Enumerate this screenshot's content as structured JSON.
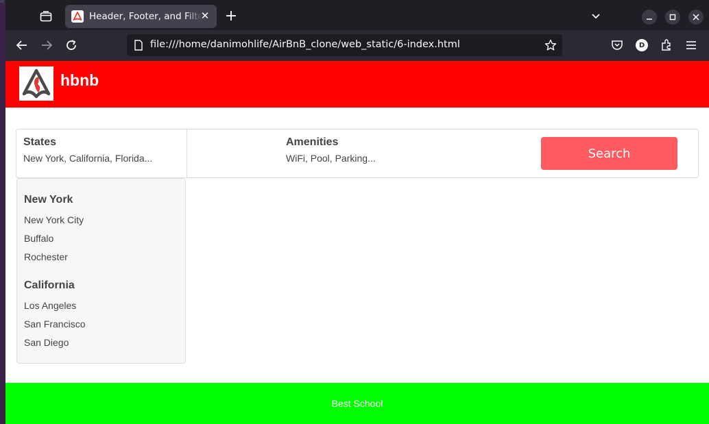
{
  "browser": {
    "tab_title": "Header, Footer, and Filters",
    "url": "file:///home/danimohlife/AirBnB_clone/web_static/6-index.html",
    "profile_initial": "D"
  },
  "site": {
    "brand": "hbnb",
    "footer_text": "Best School",
    "colors": {
      "header": "#ff0000",
      "footer": "#00ff00",
      "search_button": "#ff5a5f"
    }
  },
  "filters": {
    "states": {
      "title": "States",
      "summary": "New York, California, Florida..."
    },
    "amenities": {
      "title": "Amenities",
      "summary": "WiFi, Pool, Parking..."
    },
    "search_label": "Search"
  },
  "popover": {
    "states": [
      {
        "name": "New York",
        "cities": [
          "New York City",
          "Buffalo",
          "Rochester"
        ]
      },
      {
        "name": "California",
        "cities": [
          "Los Angeles",
          "San Francisco",
          "San Diego"
        ]
      }
    ]
  }
}
